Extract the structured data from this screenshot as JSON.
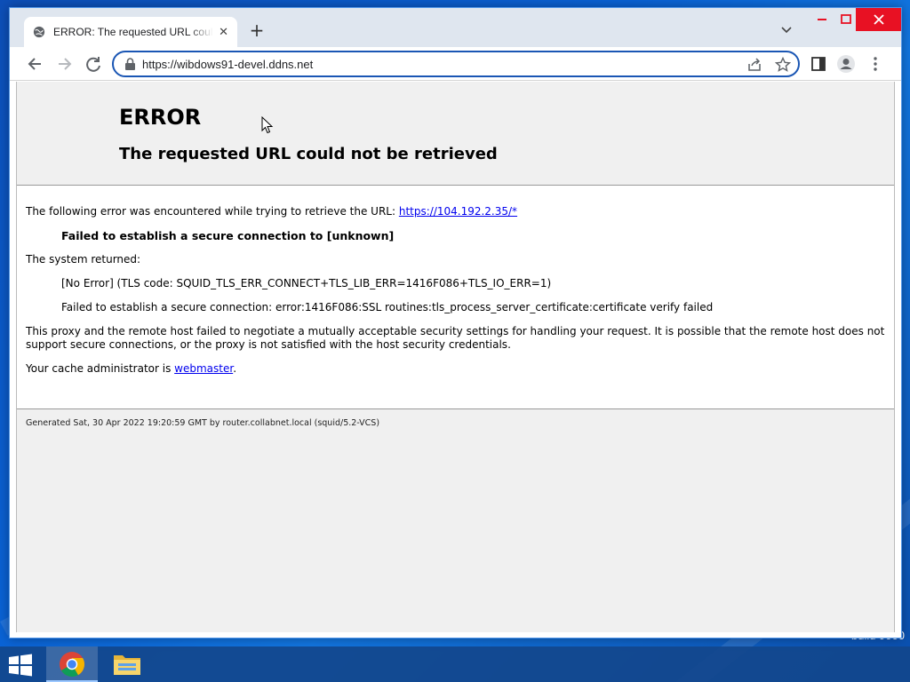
{
  "browser": {
    "tab_title": "ERROR: The requested URL could not be retrieved",
    "new_tab_symbol": "+",
    "close_tab_symbol": "✕",
    "url": "https://wibdows91-devel.ddns.net"
  },
  "page": {
    "title": "ERROR",
    "subtitle": "The requested URL could not be retrieved",
    "intro_text": "The following error was encountered while trying to retrieve the URL: ",
    "intro_link": "https://104.192.2.35/*",
    "failed_line": "Failed to establish a secure connection to [unknown]",
    "system_returned": "The system returned:",
    "tls_code": "[No Error] (TLS code: SQUID_TLS_ERR_CONNECT+TLS_LIB_ERR=1416F086+TLS_IO_ERR=1)",
    "ssl_error": "Failed to establish a secure connection: error:1416F086:SSL routines:tls_process_server_certificate:certificate verify failed",
    "explanation": "This proxy and the remote host failed to negotiate a mutually acceptable security settings for handling your request. It is possible that the remote host does not support secure connections, or the proxy is not satisfied with the host security credentials.",
    "admin_text": "Your cache administrator is ",
    "admin_link": "webmaster",
    "admin_suffix": ".",
    "footer": "Generated Sat, 30 Apr 2022 19:20:59 GMT by router.collabnet.local (squid/5.2-VCS)"
  },
  "desktop": {
    "build_text": "build 9000"
  },
  "icons": {
    "tab_favicon": "globe-icon",
    "back": "arrow-left-icon",
    "forward": "arrow-right-icon",
    "reload": "reload-icon",
    "lock": "lock-icon",
    "share": "share-icon",
    "bookmark": "star-icon",
    "side_panel": "side-panel-icon",
    "profile": "profile-icon",
    "menu": "kebab-menu-icon"
  },
  "colors": {
    "close_button": "#e81123",
    "link": "#0000ee",
    "omnibox_border": "#1a56b4"
  }
}
